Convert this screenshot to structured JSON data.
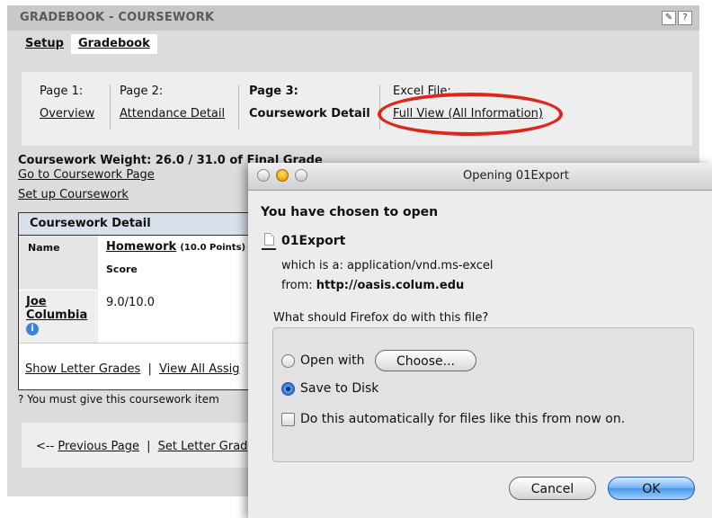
{
  "gradebook": {
    "title": "GRADEBOOK - COURSEWORK",
    "header_icons": [
      "tools-icon",
      "help-icon"
    ],
    "help_glyph": "?",
    "tabs": [
      {
        "label": "Setup"
      },
      {
        "label": "Gradebook"
      }
    ],
    "pages": [
      {
        "num": "Page 1:",
        "link": "Overview"
      },
      {
        "num": "Page 2:",
        "link": "Attendance Detail"
      },
      {
        "num": "Page 3:",
        "link": "Coursework Detail"
      },
      {
        "num": "Excel File:",
        "link": "Full View (All Information)"
      }
    ],
    "annotation_color": "#e0251a",
    "weight_text": "Coursework Weight: 26.0 / 31.0 of Final Grade",
    "goto_link": "Go to Coursework Page",
    "setup_link": "Set up Coursework",
    "table": {
      "title": "Coursework Detail",
      "name_header": "Name",
      "item_link": "Homework",
      "item_points": "(10.0 Points)",
      "score_header": "Score",
      "student": "Joe Columbia",
      "info_glyph": "i",
      "score": "9.0/10.0",
      "link_show_letter": "Show Letter Grades",
      "separator": "|",
      "link_view_all": "View All Assig"
    },
    "note": "? You must give this coursework item",
    "footer": {
      "arrow": "<--",
      "prev_link": "Previous Page",
      "separator": "|",
      "letter_link": "Set Letter Grad"
    }
  },
  "dialog": {
    "title": "Opening 01Export",
    "heading": "You have chosen to open",
    "file_name": "01Export",
    "type_label": "which is a:",
    "type_value": "application/vnd.ms-excel",
    "from_label": "from:",
    "from_value": "http://oasis.colum.edu",
    "question": "What should Firefox do with this file?",
    "open_with_label": "Open with",
    "choose_button": "Choose...",
    "save_label": "Save to Disk",
    "selected_option": "Save to Disk",
    "auto_label": "Do this automatically for files like this from now on.",
    "auto_checked": false,
    "cancel_button": "Cancel",
    "ok_button": "OK"
  }
}
